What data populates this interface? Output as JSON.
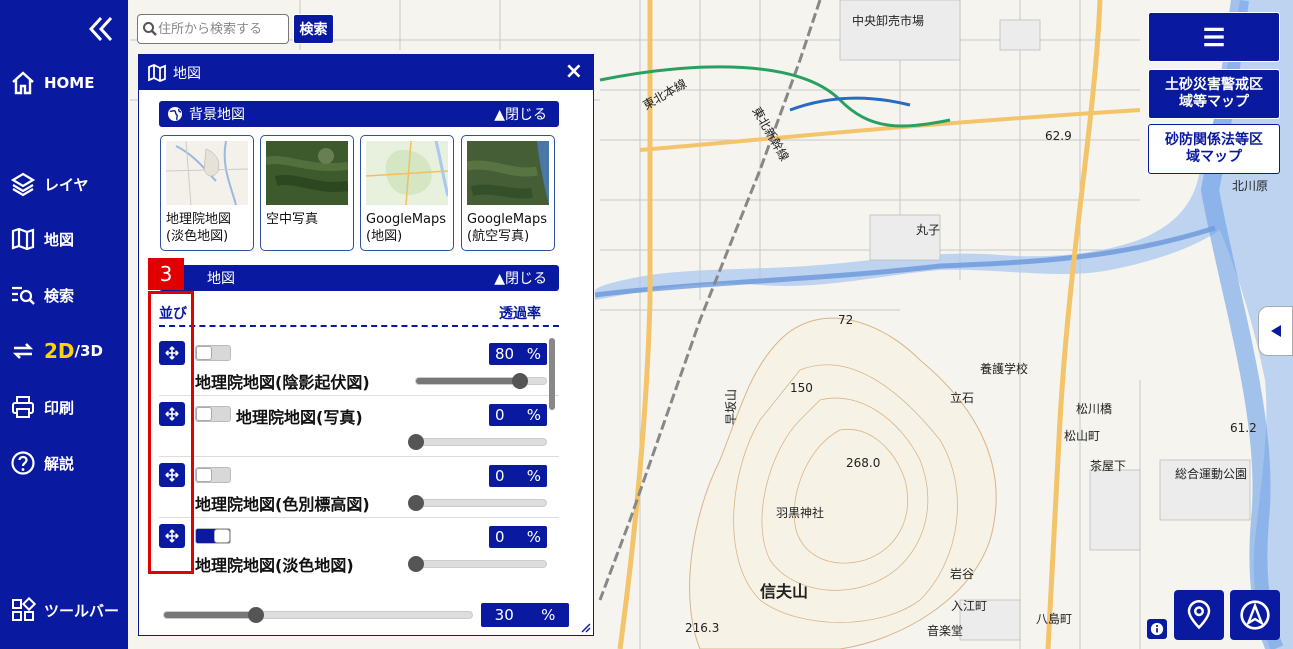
{
  "colors": {
    "primary": "#0a1aa0",
    "highlight": "#e10000",
    "accent_yellow": "#ffd400"
  },
  "sidebar": {
    "items": [
      {
        "label": "HOME",
        "icon": "home-icon"
      },
      {
        "label": "レイヤ",
        "icon": "layers-icon"
      },
      {
        "label": "地図",
        "icon": "map-icon"
      },
      {
        "label": "検索",
        "icon": "search-list-icon"
      },
      {
        "label_2d": "2D",
        "label_3d": "/3D",
        "icon": "swap-icon"
      },
      {
        "label": "印刷",
        "icon": "printer-icon"
      },
      {
        "label": "解説",
        "icon": "help-icon"
      },
      {
        "label": "ツールバー",
        "icon": "grid-icon"
      }
    ]
  },
  "search": {
    "placeholder": "住所から検索する",
    "button": "検索"
  },
  "panel": {
    "title": "地図",
    "background_section": {
      "title": "背景地図",
      "close_label": "▲閉じる"
    },
    "basemaps": [
      {
        "line1": "地理院地図",
        "line2": "(淡色地図)"
      },
      {
        "line1": "空中写真",
        "line2": ""
      },
      {
        "line1": "GoogleMaps",
        "line2": "(地図)"
      },
      {
        "line1": "GoogleMaps",
        "line2": "(航空写真)"
      }
    ],
    "overlay_section": {
      "title": "地図",
      "close_label": "▲閉じる"
    },
    "step_badge": "3",
    "col_left": "並び",
    "col_right": "透過率",
    "layers": [
      {
        "name": "地理院地図(陰影起伏図)",
        "percent": "80",
        "unit": "%",
        "on": false
      },
      {
        "name": "地理院地図(写真)",
        "percent": "0",
        "unit": "%",
        "on": false
      },
      {
        "name": "地理院地図(色別標高図)",
        "percent": "0",
        "unit": "%",
        "on": false
      },
      {
        "name": "地理院地図(淡色地図)",
        "percent": "0",
        "unit": "%",
        "on": true
      }
    ],
    "overall": {
      "percent": "30",
      "unit": "%"
    }
  },
  "right_buttons": {
    "btn1_line1": "土砂災害警戒区",
    "btn1_line2": "域等マップ",
    "btn2_line1": "砂防関係法等区",
    "btn2_line2": "域マップ"
  },
  "map_labels": {
    "market": "中央卸売市場",
    "mountain": "信夫山",
    "shrine": "羽黒神社",
    "park": "総合運動公園",
    "school": "養護学校",
    "bridge": "松川橋",
    "tate": "立石",
    "iwaya": "岩谷",
    "hachi": "八島町",
    "irie": "入江町",
    "ongaku": "音楽堂",
    "maru": "丸子",
    "chausu": "茶屋下",
    "yamaguchi": "松山町",
    "kitagawa": "北川原",
    "shinkansen": "東北新幹線",
    "tohoku": "東北本線",
    "hayasaka": "早坂山",
    "elev1": "268.0",
    "elev2": "61.2",
    "elev3": "62.9",
    "elev4": "72",
    "elev5": "216.3",
    "contour": "150"
  }
}
